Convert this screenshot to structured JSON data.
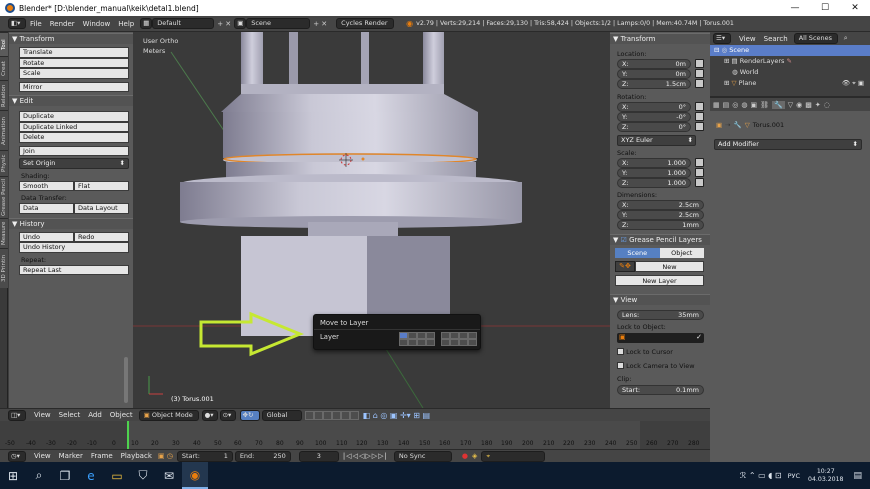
{
  "window": {
    "title": "Blender* [D:\\blender_manual\\keik\\detal1.blend]",
    "minimize": "—",
    "maximize": "☐",
    "close": "✕"
  },
  "infobar": {
    "menus": [
      "File",
      "Render",
      "Window",
      "Help"
    ],
    "layout_value": "Default",
    "scene_value": "Scene",
    "engine_value": "Cycles Render",
    "stats": "v2.79 | Verts:29,214 | Faces:29,130 | Tris:58,424 | Objects:1/2 | Lamps:0/0 | Mem:40.74M | Torus.001"
  },
  "tool_tabs": [
    "Tool",
    "Creat",
    "Relation",
    "Animation",
    "Physic",
    "Grease Pencil",
    "Measure",
    "3D Printin"
  ],
  "shelf": {
    "transform_header": "Transform",
    "transform_buttons": [
      "Translate",
      "Rotate",
      "Scale"
    ],
    "mirror": "Mirror",
    "edit_header": "Edit",
    "edit_buttons": [
      "Duplicate",
      "Duplicate Linked",
      "Delete"
    ],
    "join": "Join",
    "set_origin": "Set Origin",
    "shading_label": "Shading:",
    "smooth": "Smooth",
    "flat": "Flat",
    "data_transfer_label": "Data Transfer:",
    "data": "Data",
    "data_layout": "Data Layout",
    "history_header": "History",
    "undo": "Undo",
    "redo": "Redo",
    "undo_history": "Undo History",
    "repeat_label": "Repeat:",
    "repeat_last": "Repeat Last"
  },
  "viewport": {
    "view_name": "User Ortho",
    "units": "Meters",
    "object_label": "(3) Torus.001"
  },
  "popup": {
    "title": "Move to Layer",
    "layer_label": "Layer"
  },
  "props": {
    "transform_header": "Transform",
    "location_label": "Location:",
    "location": [
      {
        "axis": "X:",
        "value": "0m"
      },
      {
        "axis": "Y:",
        "value": "0m"
      },
      {
        "axis": "Z:",
        "value": "1.5cm"
      }
    ],
    "rotation_label": "Rotation:",
    "rotation": [
      {
        "axis": "X:",
        "value": "0°"
      },
      {
        "axis": "Y:",
        "value": "-0°"
      },
      {
        "axis": "Z:",
        "value": "0°"
      }
    ],
    "rotation_mode": "XYZ Euler",
    "scale_label": "Scale:",
    "scale": [
      {
        "axis": "X:",
        "value": "1.000"
      },
      {
        "axis": "Y:",
        "value": "1.000"
      },
      {
        "axis": "Z:",
        "value": "1.000"
      }
    ],
    "dimensions_label": "Dimensions:",
    "dimensions": [
      {
        "axis": "X:",
        "value": "2.5cm"
      },
      {
        "axis": "Y:",
        "value": "2.5cm"
      },
      {
        "axis": "Z:",
        "value": "1mm"
      }
    ],
    "grease_header": "Grease Pencil Layers",
    "scene_tab": "Scene",
    "object_tab": "Object",
    "new": "New",
    "new_layer": "New Layer",
    "view_header": "View",
    "lens_label": "Lens:",
    "lens_value": "35mm",
    "lock_object_label": "Lock to Object:",
    "lock_cursor": "Lock to Cursor",
    "lock_camera": "Lock Camera to View",
    "clip_label": "Clip:",
    "clip_start_label": "Start:",
    "clip_start_value": "0.1mm"
  },
  "outliner": {
    "view": "View",
    "search": "Search",
    "scenes_value": "All Scenes",
    "items": [
      "Scene",
      "RenderLayers",
      "World",
      "Plane"
    ]
  },
  "outprops": {
    "object_name": "Torus.001",
    "add_modifier": "Add Modifier"
  },
  "view3d_header": {
    "menus": [
      "View",
      "Select",
      "Add",
      "Object"
    ],
    "mode": "Object Mode",
    "orientation": "Global"
  },
  "timeline": {
    "ticks": [
      "-50",
      "-40",
      "-30",
      "-20",
      "-10",
      "0",
      "10",
      "20",
      "30",
      "40",
      "50",
      "60",
      "70",
      "80",
      "90",
      "100",
      "110",
      "120",
      "130",
      "140",
      "150",
      "160",
      "170",
      "180",
      "190",
      "200",
      "210",
      "220",
      "230",
      "240",
      "250",
      "260",
      "270",
      "280"
    ],
    "current_frame": 3
  },
  "timeline_header": {
    "menus": [
      "View",
      "Marker",
      "Frame",
      "Playback"
    ],
    "start_label": "Start:",
    "start_value": "1",
    "end_label": "End:",
    "end_value": "250",
    "current": "3",
    "sync": "No Sync"
  },
  "taskbar": {
    "lang": "РУС",
    "time": "10:27",
    "date": "04.03.2018"
  }
}
